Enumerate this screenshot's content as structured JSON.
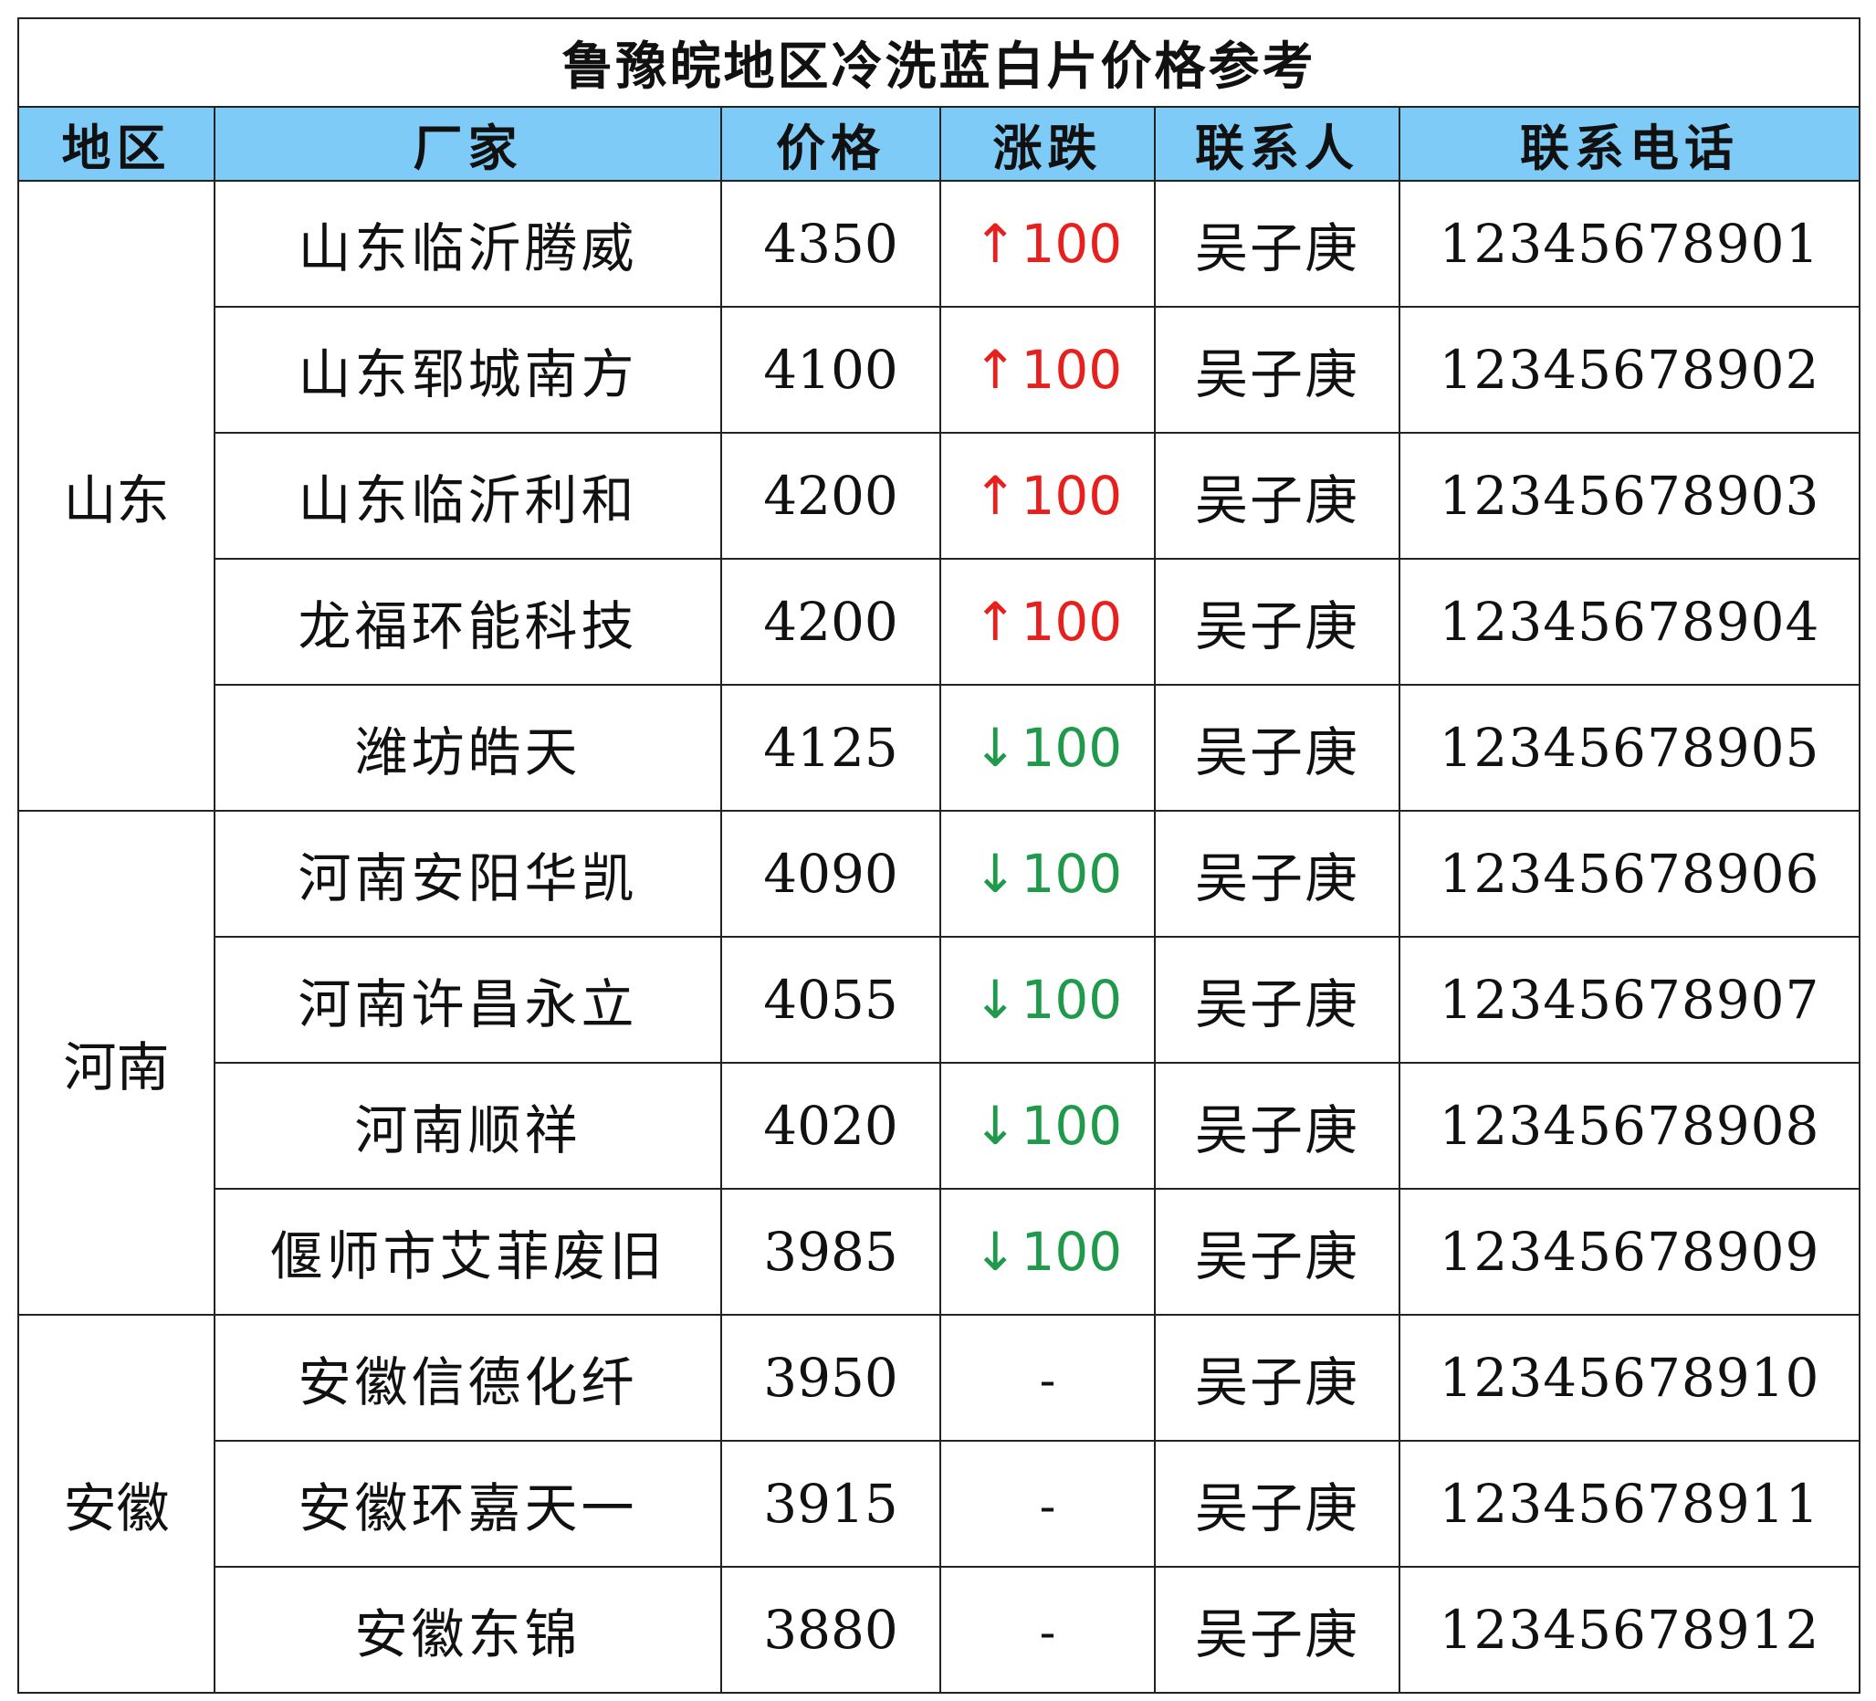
{
  "title": "鲁豫皖地区冷洗蓝白片价格参考",
  "colors": {
    "header_bg": "#7ecbf8",
    "up": "#e8201d",
    "down": "#1e9a4a",
    "border": "#222222"
  },
  "headers": {
    "region": "地区",
    "factory": "厂家",
    "price": "价格",
    "change": "涨跌",
    "contact": "联系人",
    "phone": "联系电话"
  },
  "regions": [
    "山东",
    "河南",
    "安徽"
  ],
  "rows": [
    {
      "factory": "山东临沂腾威",
      "price": "4350",
      "arrow": "↑",
      "amount": "100",
      "contact": "吴子庚",
      "phone": "12345678901"
    },
    {
      "factory": "山东郓城南方",
      "price": "4100",
      "arrow": "↑",
      "amount": "100",
      "contact": "吴子庚",
      "phone": "12345678902"
    },
    {
      "factory": "山东临沂利和",
      "price": "4200",
      "arrow": "↑",
      "amount": "100",
      "contact": "吴子庚",
      "phone": "12345678903"
    },
    {
      "factory": "龙福环能科技",
      "price": "4200",
      "arrow": "↑",
      "amount": "100",
      "contact": "吴子庚",
      "phone": "12345678904"
    },
    {
      "factory": "潍坊皓天",
      "price": "4125",
      "arrow": "↓",
      "amount": "100",
      "contact": "吴子庚",
      "phone": "12345678905"
    },
    {
      "factory": "河南安阳华凯",
      "price": "4090",
      "arrow": "↓",
      "amount": "100",
      "contact": "吴子庚",
      "phone": "12345678906"
    },
    {
      "factory": "河南许昌永立",
      "price": "4055",
      "arrow": "↓",
      "amount": "100",
      "contact": "吴子庚",
      "phone": "12345678907"
    },
    {
      "factory": "河南顺祥",
      "price": "4020",
      "arrow": "↓",
      "amount": "100",
      "contact": "吴子庚",
      "phone": "12345678908"
    },
    {
      "factory": "偃师市艾菲废旧",
      "price": "3985",
      "arrow": "↓",
      "amount": "100",
      "contact": "吴子庚",
      "phone": "12345678909"
    },
    {
      "factory": "安徽信德化纤",
      "price": "3950",
      "arrow": "",
      "amount": "-",
      "contact": "吴子庚",
      "phone": "12345678910"
    },
    {
      "factory": "安徽环嘉天一",
      "price": "3915",
      "arrow": "",
      "amount": "-",
      "contact": "吴子庚",
      "phone": "12345678911"
    },
    {
      "factory": "安徽东锦",
      "price": "3880",
      "arrow": "",
      "amount": "-",
      "contact": "吴子庚",
      "phone": "12345678912"
    }
  ]
}
